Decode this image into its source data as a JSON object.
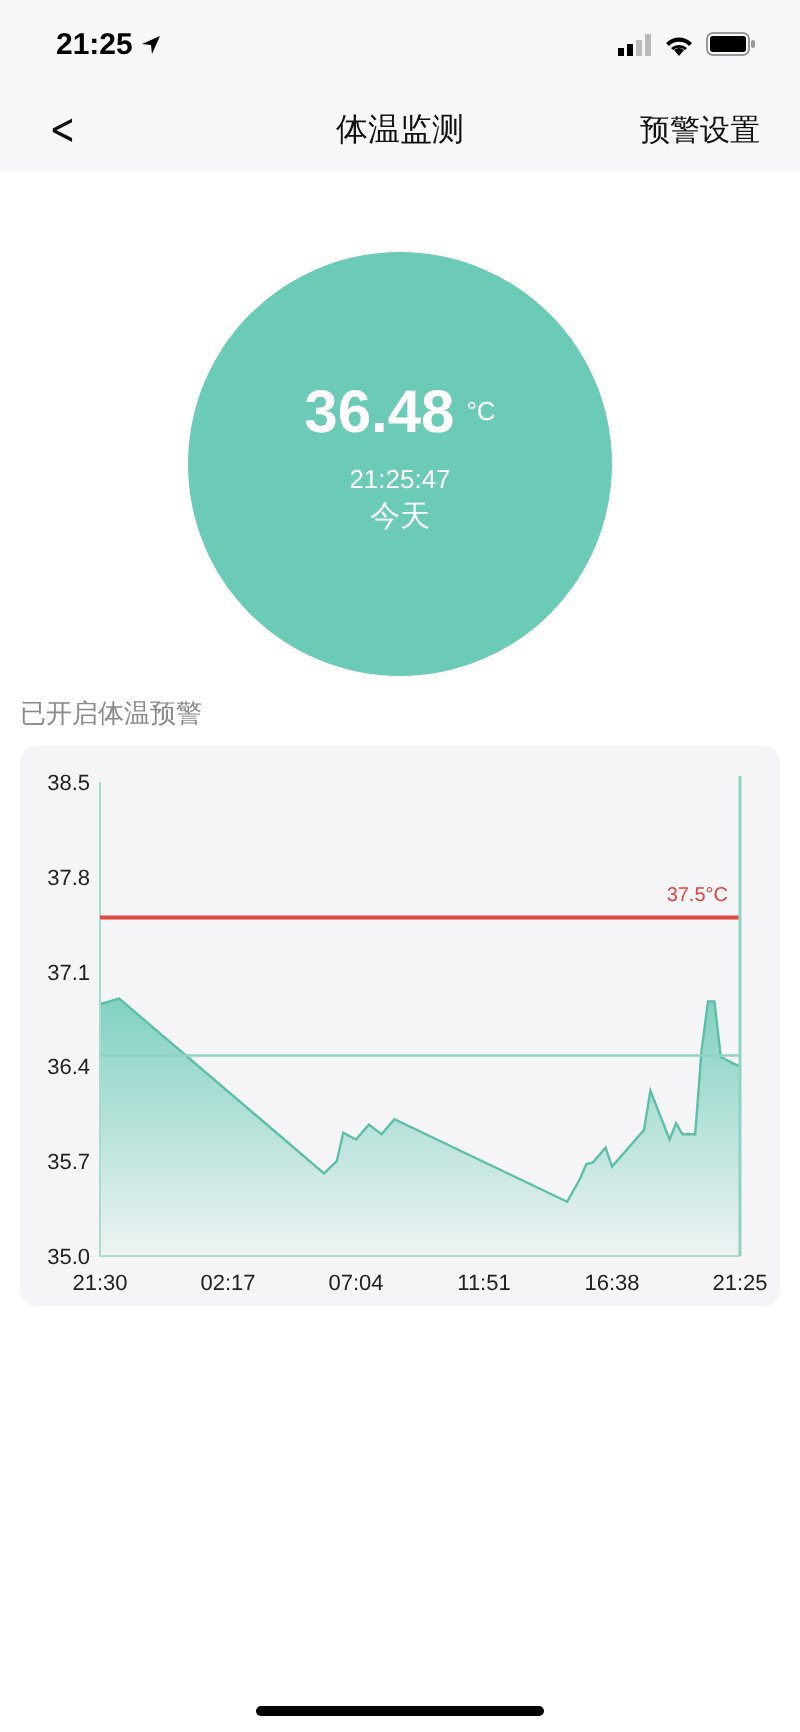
{
  "status_bar": {
    "time": "21:25"
  },
  "nav": {
    "back": "<",
    "title": "体温监测",
    "action": "预警设置"
  },
  "reading": {
    "value": "36.48",
    "unit": "°C",
    "time": "21:25:47",
    "day": "今天"
  },
  "alert_label": "已开启体温预警",
  "chart": {
    "chart_data": {
      "type": "area",
      "categories": [
        "21:30",
        null,
        null,
        null,
        null,
        null,
        null,
        null,
        null,
        null,
        null,
        null,
        null,
        null,
        null,
        null,
        null,
        null,
        null,
        null,
        "02:17",
        null,
        null,
        null,
        null,
        null,
        null,
        null,
        null,
        null,
        null,
        null,
        null,
        null,
        null,
        null,
        null,
        null,
        null,
        null,
        "07:04",
        null,
        null,
        null,
        null,
        null,
        null,
        null,
        null,
        null,
        null,
        null,
        null,
        null,
        null,
        null,
        null,
        null,
        null,
        null,
        "11:51",
        null,
        null,
        null,
        null,
        null,
        null,
        null,
        null,
        null,
        null,
        null,
        null,
        null,
        null,
        null,
        null,
        null,
        null,
        null,
        "16:38",
        null,
        null,
        null,
        null,
        null,
        null,
        null,
        null,
        null,
        null,
        null,
        null,
        null,
        null,
        null,
        null,
        null,
        null,
        null,
        "21:25"
      ],
      "series": [
        {
          "color": "#5cbfa8",
          "values": [
            36.86,
            null,
            null,
            36.9,
            null,
            null,
            null,
            null,
            null,
            null,
            null,
            null,
            null,
            null,
            null,
            null,
            null,
            null,
            null,
            null,
            null,
            null,
            null,
            null,
            null,
            null,
            null,
            null,
            null,
            null,
            null,
            null,
            null,
            null,
            null,
            35.61,
            null,
            35.7,
            35.91,
            null,
            35.86,
            null,
            35.97,
            null,
            35.9,
            null,
            36.01,
            null,
            null,
            null,
            null,
            null,
            null,
            null,
            null,
            null,
            null,
            null,
            null,
            null,
            null,
            null,
            null,
            null,
            null,
            null,
            null,
            null,
            null,
            null,
            null,
            null,
            null,
            35.4,
            null,
            35.57,
            35.68,
            35.69,
            null,
            35.8,
            35.66,
            null,
            null,
            null,
            null,
            35.93,
            36.22,
            null,
            null,
            35.86,
            35.98,
            35.9,
            null,
            35.9,
            36.52,
            36.88,
            36.88,
            36.47,
            null,
            36.42,
            36.4
          ]
        }
      ],
      "ylim": [
        35.0,
        38.5
      ],
      "yticks": [
        {
          "value": 35.0,
          "label": "35.0"
        },
        {
          "value": 35.7,
          "label": "35.7"
        },
        {
          "value": 36.4,
          "label": "36.4"
        },
        {
          "value": 37.1,
          "label": "37.1"
        },
        {
          "value": 37.8,
          "label": "37.8"
        },
        {
          "value": 38.5,
          "label": "38.5"
        }
      ],
      "ref_lines": [
        {
          "axis": "y",
          "value": 37.5,
          "label": "37.5°C",
          "color": "#e0453f"
        },
        {
          "axis": "y",
          "value": 36.48,
          "color": "#8ed3c3"
        },
        {
          "axis": "x",
          "value": "21:25",
          "color": "#8ed3c3"
        }
      ]
    }
  }
}
